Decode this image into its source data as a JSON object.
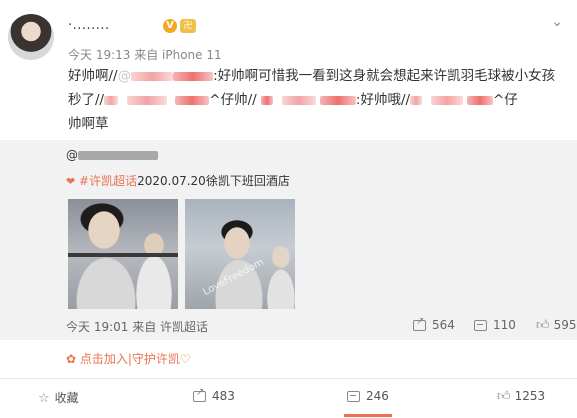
{
  "post": {
    "username_masked": "·........",
    "v_badge": "V",
    "level_badge": "卍",
    "meta": "今天 19:13 来自 iPhone 11",
    "text": {
      "seg1": "好帅啊//",
      "seg2": ":好帅啊可惜我一看到这身就会想起来许凯羽毛球被小女孩",
      "seg3": "秒了//",
      "seg4": "^仔帅//",
      "seg5": ":好帅哦//",
      "seg6": "^仔",
      "seg7": "帅啊草"
    }
  },
  "repost": {
    "orig_user_prefix": "@",
    "topic_tag": "#许凯超话",
    "topic_text": "2020.07.20徐凯下班回酒店",
    "watermark": "LoveFreedom",
    "meta": "今天 19:01 来自 许凯超话",
    "shares": "564",
    "comments": "110",
    "likes": "595",
    "support": "点击加入|守护许凯♡"
  },
  "actions": {
    "favorite": "收藏",
    "share": "483",
    "comment": "246",
    "like": "1253"
  },
  "colors": {
    "accent": "#eb7350",
    "repost_bg": "#f2f2f2"
  }
}
